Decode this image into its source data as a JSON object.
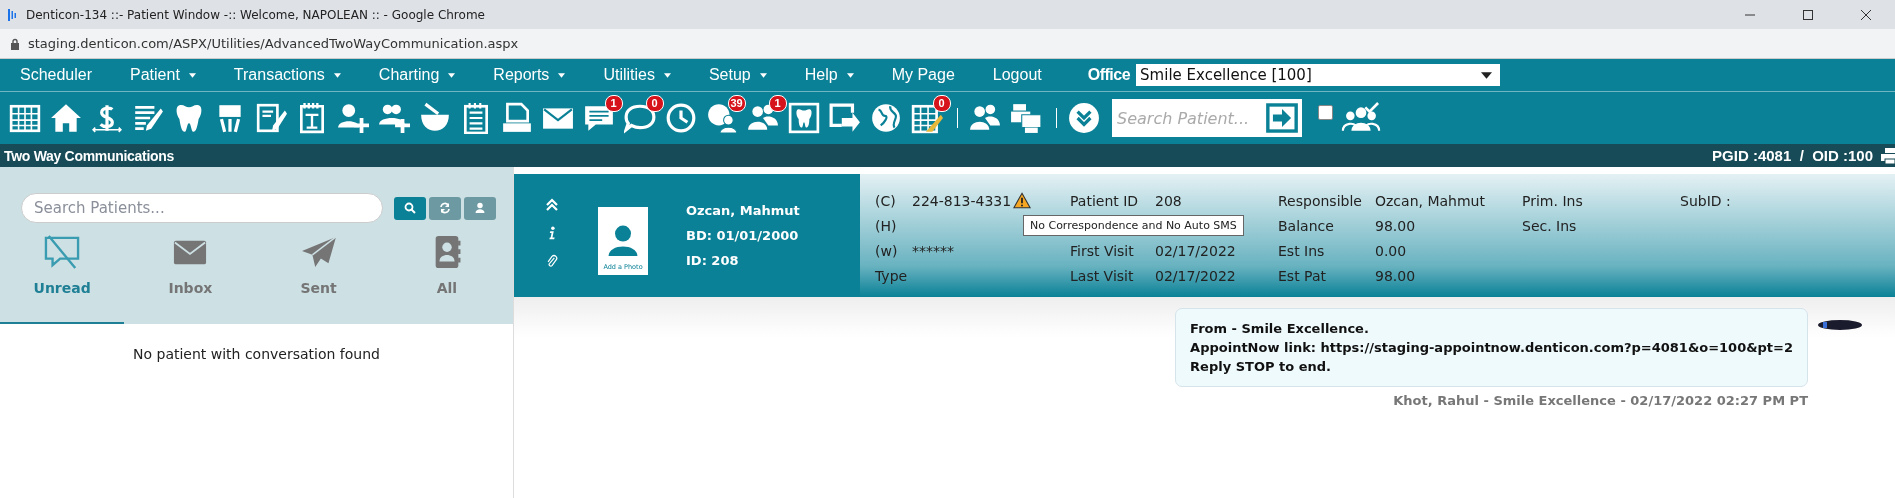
{
  "browser": {
    "title": "Denticon-134 ::- Patient Window -:: Welcome, NAPOLEAN :: - Google Chrome",
    "url": "staging.denticon.com/ASPX/Utilities/AdvancedTwoWayCommunication.aspx"
  },
  "menu": [
    {
      "label": "Scheduler",
      "dropdown": false
    },
    {
      "label": "Patient",
      "dropdown": true
    },
    {
      "label": "Transactions",
      "dropdown": true
    },
    {
      "label": "Charting",
      "dropdown": true
    },
    {
      "label": "Reports",
      "dropdown": true
    },
    {
      "label": "Utilities",
      "dropdown": true
    },
    {
      "label": "Setup",
      "dropdown": true
    },
    {
      "label": "Help",
      "dropdown": true
    },
    {
      "label": "My Page",
      "dropdown": false
    },
    {
      "label": "Logout",
      "dropdown": false
    }
  ],
  "office": {
    "label": "Office",
    "value": "Smile Excellence [100]"
  },
  "toolbar": {
    "badges": [
      "1",
      "0",
      "39",
      "1",
      "0"
    ],
    "search": {
      "placeholder": "Search Patient..."
    },
    "checkbox": {
      "checked": false
    }
  },
  "page": {
    "title": "Two Way Communications",
    "ids": "PGID :4081  /  OID :100"
  },
  "left_panel": {
    "search": {
      "placeholder": "Search Patients..."
    },
    "tabs": [
      {
        "label": "Unread",
        "selected": true
      },
      {
        "label": "Inbox",
        "selected": false
      },
      {
        "label": "Sent",
        "selected": false
      },
      {
        "label": "All",
        "selected": false
      }
    ],
    "empty_message": "No patient with conversation found"
  },
  "patient": {
    "photo_label": "Add a Photo",
    "name": "Ozcan, Mahmut",
    "birth_date": "BD: 01/01/2000",
    "id": "ID: 208",
    "contact": [
      {
        "label": "(C)",
        "value": "224-813-4331",
        "warning": true
      },
      {
        "label": "(H)",
        "warning": false
      },
      {
        "label": "(w)",
        "value": "******",
        "warning": false
      },
      {
        "label": "Type",
        "warning": false
      }
    ],
    "visits": [
      {
        "kind": "field",
        "label": "Patient ID",
        "value": "208"
      },
      {
        "kind": "tooltip",
        "text": "No Correspondence and No Auto SMS"
      },
      {
        "kind": "field",
        "label": "First Visit",
        "value": "02/17/2022"
      },
      {
        "kind": "field",
        "label": "Last Visit",
        "value": "02/17/2022"
      }
    ],
    "account": [
      {
        "label": "Responsible",
        "value": "Ozcan, Mahmut"
      },
      {
        "label": "Balance",
        "value": "98.00"
      },
      {
        "label": "Est Ins",
        "value": "0.00"
      },
      {
        "label": "Est Pat",
        "value": "98.00"
      }
    ],
    "insurance": [
      "Prim. Ins",
      "Sec. Ins"
    ],
    "sub_id": "SubID :"
  },
  "message": {
    "lines": [
      "From - Smile Excellence.",
      "AppointNow link: https://staging-appointnow.denticon.com?p=4081&o=100&pt=2",
      "Reply STOP to end."
    ],
    "meta": "Khot, Rahul - Smile Excellence - 02/17/2022 02:27 PM PT"
  }
}
